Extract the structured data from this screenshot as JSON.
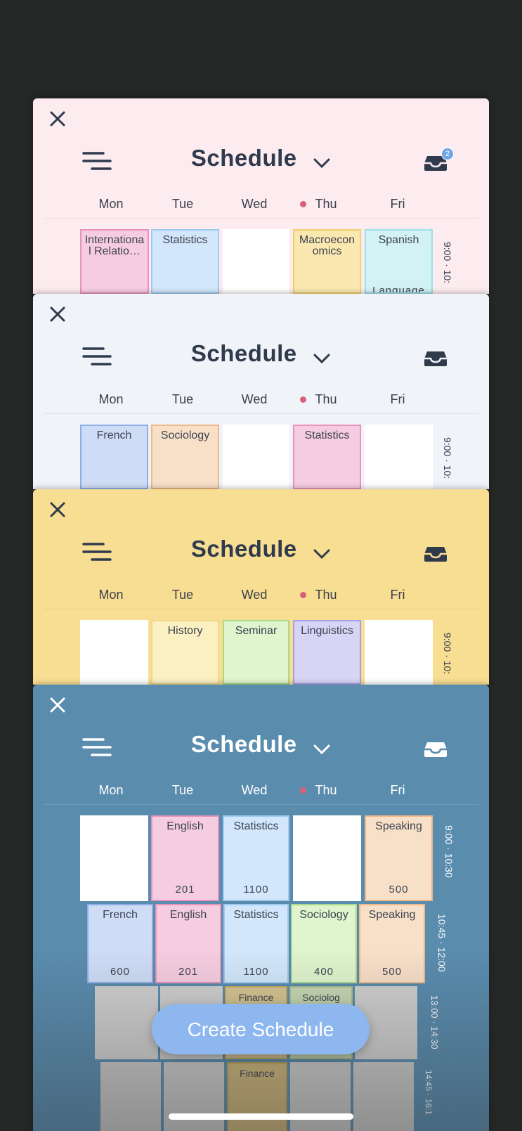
{
  "days": [
    "Mon",
    "Tue",
    "Wed",
    "Thu",
    "Fri"
  ],
  "title": "Schedule",
  "cards": [
    {
      "notification_count": "2",
      "row1": [
        "International Relatio…",
        "Statistics",
        "",
        "Macroeconomics",
        "Spanish"
      ],
      "row1_extra": "Language",
      "time1": "9:00 · 10:"
    },
    {
      "row1": [
        "French",
        "Sociology",
        "",
        "Statistics",
        ""
      ],
      "time1": "9:00 · 10:"
    },
    {
      "row1": [
        "",
        "History",
        "Seminar",
        "Linguistics",
        ""
      ],
      "time1": "9:00 · 10:"
    },
    {
      "row1": [
        "",
        "English",
        "Statistics",
        "",
        "Speaking"
      ],
      "row1_rooms": [
        "",
        "201",
        "1100",
        "",
        "500"
      ],
      "row2": [
        "French",
        "English",
        "Statistics",
        "Sociology",
        "Speaking"
      ],
      "row2_rooms": [
        "600",
        "201",
        "1100",
        "400",
        "500"
      ],
      "row3": [
        "",
        "",
        "Finance",
        "Sociolog",
        ""
      ],
      "row4": [
        "",
        "",
        "Finance",
        "",
        ""
      ],
      "times": [
        "9:00 · 10:30",
        "10:45 · 12:00",
        "13:00 · 14:30",
        "14:45 · 16:1"
      ]
    }
  ],
  "create_button": "Create Schedule",
  "colors": {
    "background": "#252626",
    "card1": "#fcecef",
    "card2": "#f0f4f9",
    "card3": "#f8de92",
    "card4": "#5a8cae",
    "accent_dot": "#d9607a",
    "button": "#8db7ee"
  },
  "icons": [
    "close-icon",
    "menu-icon",
    "chevron-down-icon",
    "inbox-icon"
  ]
}
